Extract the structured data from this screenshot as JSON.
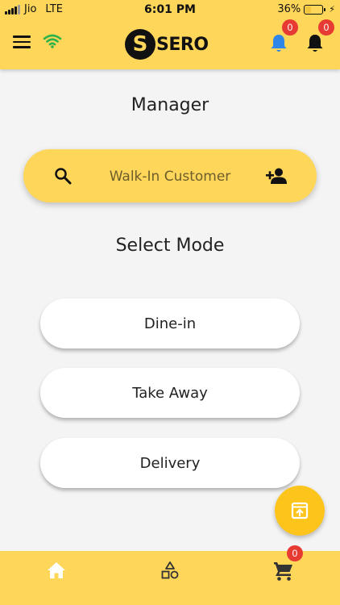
{
  "status_bar": {
    "carrier": "Jio",
    "network": "LTE",
    "time": "6:01 PM",
    "battery_percent": "36%",
    "battery_level": 0.36
  },
  "app_bar": {
    "logo_mark": "S",
    "logo_text": "SERO",
    "notifications": [
      {
        "icon": "bell-icon",
        "color": "#2e86e8",
        "count": "0"
      },
      {
        "icon": "bell-icon",
        "color": "#111111",
        "count": "0"
      }
    ]
  },
  "main": {
    "title": "Manager",
    "customer": {
      "label": "Walk-In Customer"
    },
    "mode_title": "Select Mode",
    "modes": [
      {
        "label": "Dine-in"
      },
      {
        "label": "Take Away"
      },
      {
        "label": "Delivery"
      }
    ]
  },
  "bottom_nav": {
    "cart_count": "0"
  },
  "colors": {
    "brand_yellow": "#fed65a",
    "fab_yellow": "#fdc51c",
    "badge_red": "#e63a32",
    "wifi_green": "#2db34a"
  }
}
